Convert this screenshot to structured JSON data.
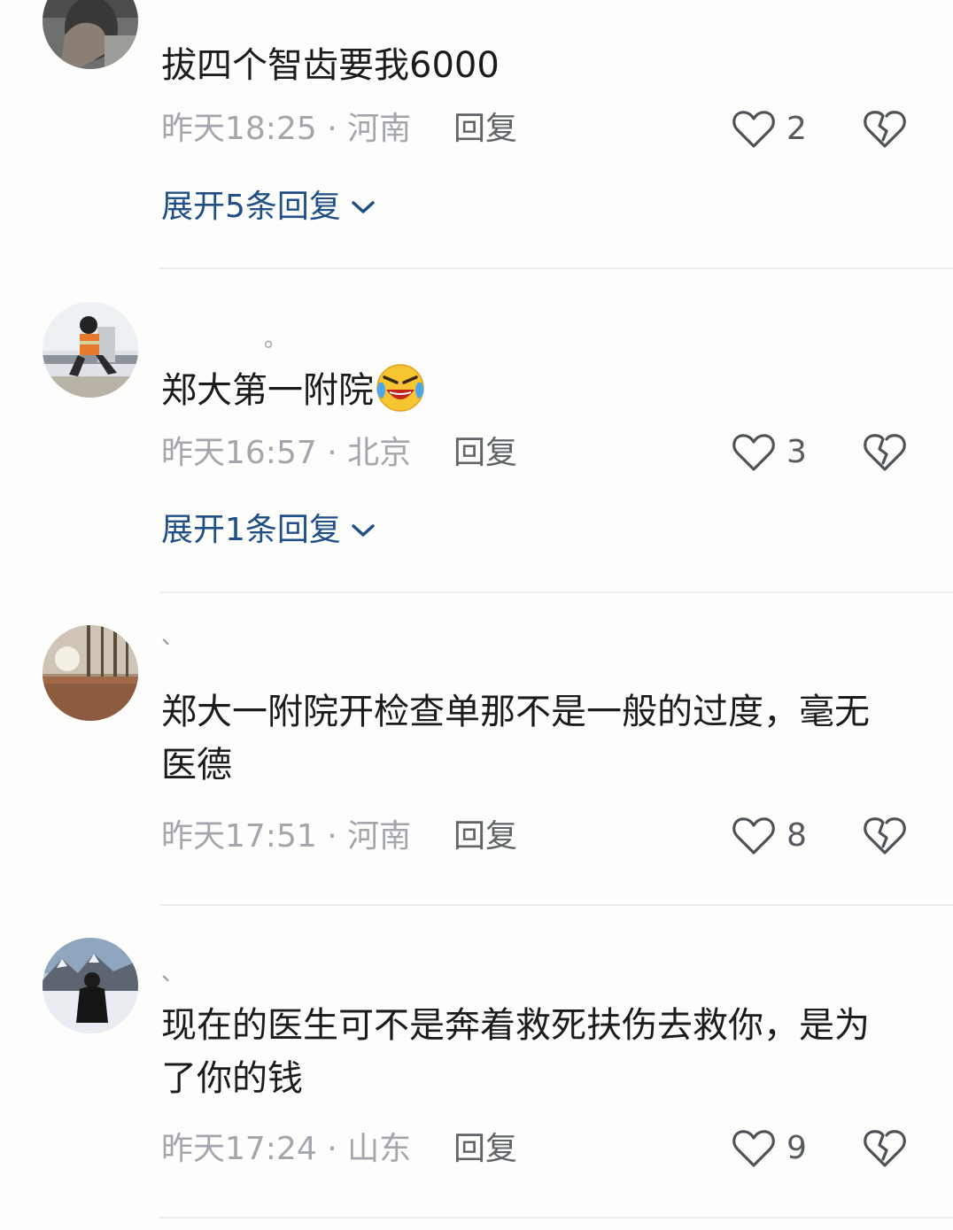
{
  "comments": [
    {
      "username": "",
      "text": "拔四个智齿要我6000",
      "time": "昨天18:25",
      "location": "河南",
      "reply_label": "回复",
      "likes": "2",
      "expand_label": "展开5条回复"
    },
    {
      "username": "。",
      "text": "郑大第一附院",
      "emoji": "crying-laughing-emoji",
      "time": "昨天16:57",
      "location": "北京",
      "reply_label": "回复",
      "likes": "3",
      "expand_label": "展开1条回复"
    },
    {
      "username": "、",
      "text": "郑大一附院开检查单那不是一般的过度，毫无医德",
      "time": "昨天17:51",
      "location": "河南",
      "reply_label": "回复",
      "likes": "8"
    },
    {
      "username": "、",
      "text": "现在的医生可不是奔着救死扶伤去救你，是为了你的钱",
      "time": "昨天17:24",
      "location": "山东",
      "reply_label": "回复",
      "likes": "9"
    }
  ],
  "meta_separator": " · ",
  "colors": {
    "link": "#1f4f86",
    "meta": "#a3a7ad",
    "text": "#1b1b1b"
  }
}
